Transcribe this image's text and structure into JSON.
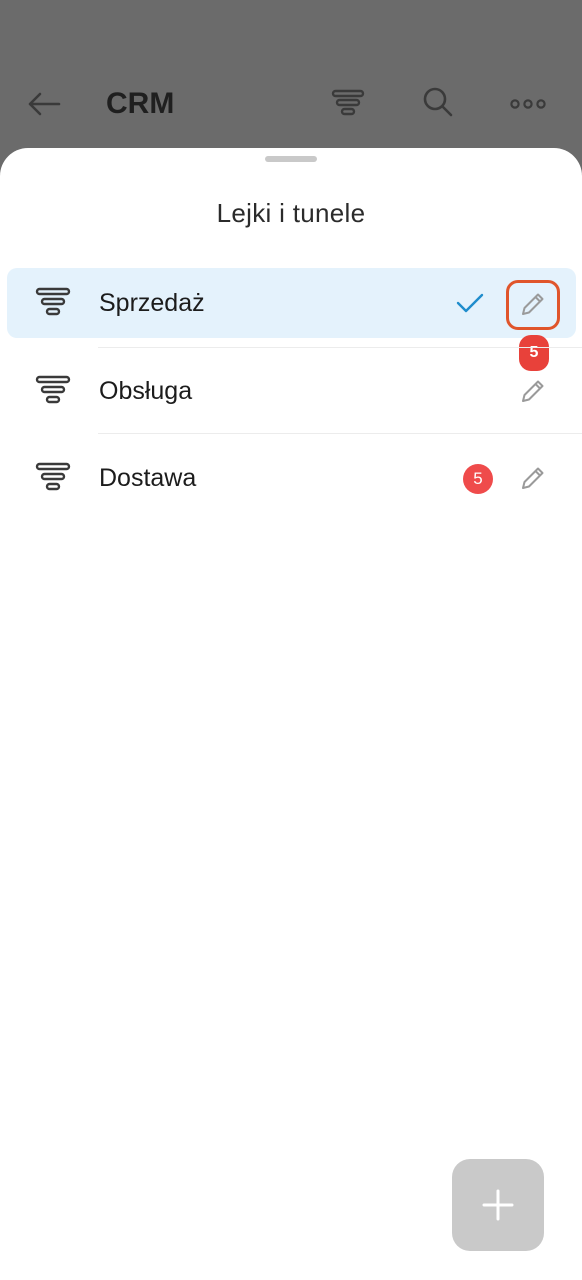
{
  "appbar": {
    "title": "CRM",
    "icons": [
      "arrow-left-icon",
      "funnel-icon",
      "search-icon",
      "more-horizontal-icon"
    ]
  },
  "sheet": {
    "title": "Lejki i tunele",
    "items": [
      {
        "label": "Sprzedaż",
        "selected": true,
        "annotation_badge": "5"
      },
      {
        "label": "Obsługa",
        "selected": false
      },
      {
        "label": "Dostawa",
        "selected": false,
        "count_badge": "5"
      }
    ]
  },
  "colors": {
    "accent": "#1f8dcc",
    "selected_bg": "#e4f2fc",
    "highlight": "#e0552b",
    "badge": "#ef4b4b",
    "fab": "#c9c9c9"
  }
}
